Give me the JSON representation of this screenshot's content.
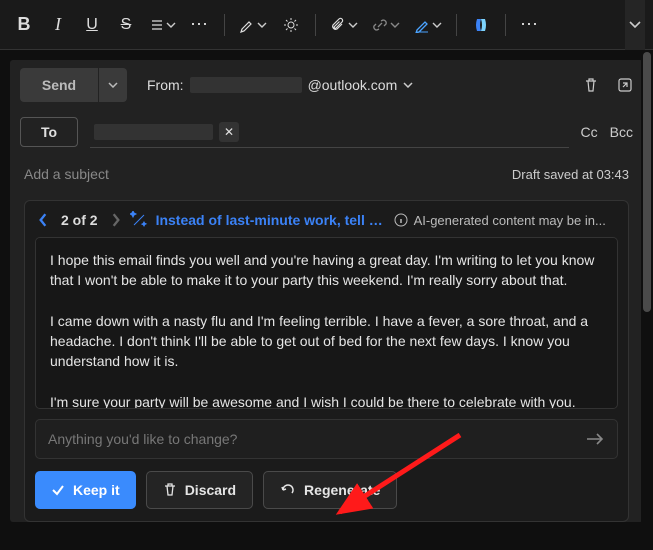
{
  "toolbar": {
    "more1": "⋯",
    "more2": "⋯"
  },
  "compose": {
    "send_label": "Send",
    "from_label": "From:",
    "from_address": "@outlook.com",
    "to_label": "To",
    "cc_label": "Cc",
    "bcc_label": "Bcc",
    "subject_placeholder": "Add a subject",
    "draft_saved": "Draft saved at 03:43"
  },
  "ai": {
    "count": "2 of 2",
    "title": "Instead of last-minute work, tell hi...",
    "info_text": "AI-generated content may be in...",
    "body_p1": "I hope this email finds you well and you're having a great day. I'm writing to let you know that I won't be able to make it to your party this weekend. I'm really sorry about that.",
    "body_p2": "I came down with a nasty flu and I'm feeling terrible. I have a fever, a sore throat, and a headache. I don't think I'll be able to get out of bed for the next few days. I know you understand how it is.",
    "body_p3": "I'm sure your party will be awesome and I wish I could be there to celebrate with you.",
    "input_placeholder": "Anything you'd like to change?",
    "keep_label": "Keep it",
    "discard_label": "Discard",
    "regenerate_label": "Regenerate"
  }
}
